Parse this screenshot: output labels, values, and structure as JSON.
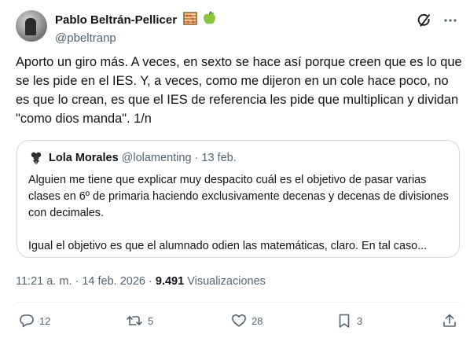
{
  "author": {
    "name": "Pablo Beltrán-Pellicer",
    "handle": "@pbeltranp",
    "emojis": [
      "abacus",
      "green-apple"
    ]
  },
  "tweet": {
    "text": "Aporto un giro más. A veces, en sexto se hace así porque creen que es lo que se les pide en el IES. Y, a veces, como me dijeron en un cole hace poco, no es que lo crean, es que el IES de referencia les pide que multiplican y dividan \"como dios manda\". 1/n"
  },
  "quoted": {
    "name": "Lola Morales",
    "handle_date": "@lolamenting · 13 feb.",
    "paragraph1": "Alguien me tiene que explicar muy despacito cuál es el objetivo de pasar varias clases en 6º de primaria haciendo exclusivamente decenas y decenas de divisiones con decimales.",
    "paragraph2": "Igual el objetivo es que el alumnado odien las matemáticas, claro. En tal caso..."
  },
  "meta": {
    "time_date": "11:21 a. m. · 14 feb. 2026 · ",
    "views_count": "9.491",
    "views_label": " Visualizaciones"
  },
  "actions": {
    "replies": "12",
    "reposts": "5",
    "likes": "28",
    "bookmarks": "3"
  },
  "colors": {
    "text": "#0f1419",
    "secondary": "#536471",
    "border": "#cfd9de"
  }
}
